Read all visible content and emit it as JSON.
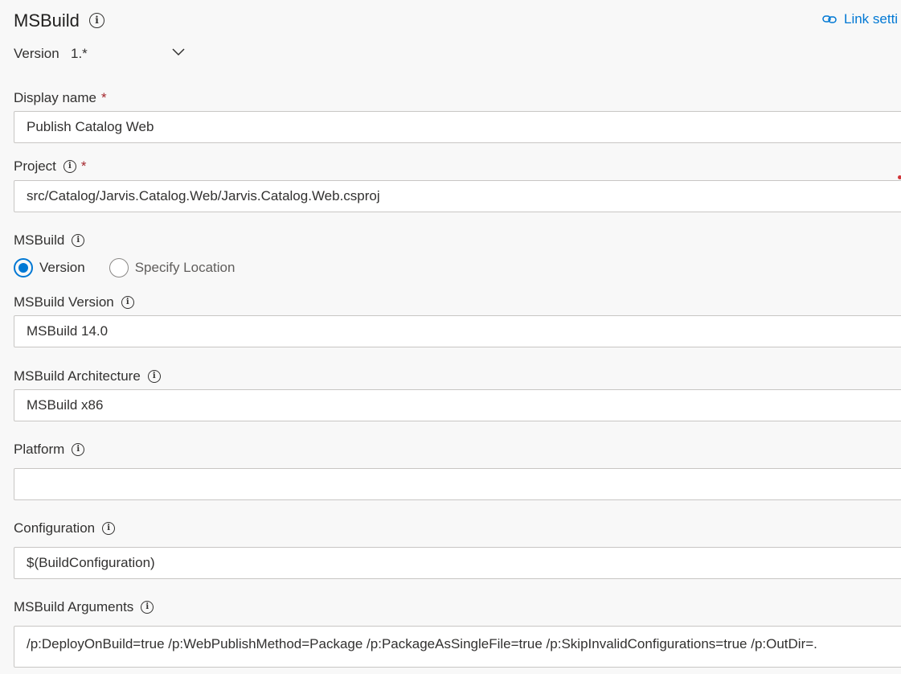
{
  "task": {
    "title": "MSBuild",
    "link_settings_label": "Link setti",
    "version_label": "Version",
    "version_value": "1.*"
  },
  "fields": {
    "display_name": {
      "label": "Display name",
      "required_marker": "*",
      "value": "Publish Catalog Web"
    },
    "project": {
      "label": "Project",
      "required_marker": "*",
      "value": "src/Catalog/Jarvis.Catalog.Web/Jarvis.Catalog.Web.csproj"
    },
    "msbuild": {
      "label": "MSBuild",
      "options": [
        "Version",
        "Specify Location"
      ],
      "selected": "Version"
    },
    "msbuild_version": {
      "label": "MSBuild Version",
      "value": "MSBuild 14.0"
    },
    "msbuild_architecture": {
      "label": "MSBuild Architecture",
      "value": "MSBuild x86"
    },
    "platform": {
      "label": "Platform",
      "value": ""
    },
    "configuration": {
      "label": "Configuration",
      "value": "$(BuildConfiguration)"
    },
    "msbuild_arguments": {
      "label": "MSBuild Arguments",
      "value": "/p:DeployOnBuild=true /p:WebPublishMethod=Package /p:PackageAsSingleFile=true /p:SkipInvalidConfigurations=true /p:OutDir=."
    }
  },
  "icons": {
    "info": "info-icon",
    "link": "link-icon",
    "chevron": "chevron-down-icon"
  },
  "colors": {
    "accent": "#0078d4",
    "required": "#a4262c",
    "background": "#f8f8f8",
    "input_border": "#c8c6c4"
  }
}
